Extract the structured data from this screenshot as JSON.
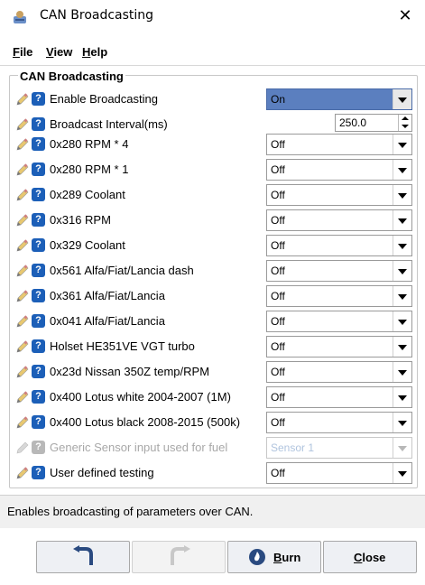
{
  "window": {
    "title": "CAN Broadcasting",
    "close_glyph": "✕"
  },
  "menu": [
    {
      "label": "File"
    },
    {
      "label": "View"
    },
    {
      "label": "Help"
    }
  ],
  "panel": {
    "title": "CAN Broadcasting"
  },
  "rows": [
    {
      "label": "Enable Broadcasting",
      "value": "On",
      "kind": "select"
    },
    {
      "label": "Broadcast Interval(ms)",
      "value": "250.0",
      "kind": "spinner"
    },
    {
      "label": "0x280 RPM * 4",
      "value": "Off",
      "kind": "select"
    },
    {
      "label": "0x280 RPM * 1",
      "value": "Off",
      "kind": "select"
    },
    {
      "label": "0x289 Coolant",
      "value": "Off",
      "kind": "select"
    },
    {
      "label": "0x316 RPM",
      "value": "Off",
      "kind": "select"
    },
    {
      "label": "0x329 Coolant",
      "value": "Off",
      "kind": "select"
    },
    {
      "label": "0x561 Alfa/Fiat/Lancia dash",
      "value": "Off",
      "kind": "select"
    },
    {
      "label": "0x361 Alfa/Fiat/Lancia",
      "value": "Off",
      "kind": "select"
    },
    {
      "label": "0x041 Alfa/Fiat/Lancia",
      "value": "Off",
      "kind": "select"
    },
    {
      "label": "Holset HE351VE VGT turbo",
      "value": "Off",
      "kind": "select"
    },
    {
      "label": "0x23d Nissan 350Z temp/RPM",
      "value": "Off",
      "kind": "select"
    },
    {
      "label": "0x400 Lotus white 2004-2007 (1M)",
      "value": "Off",
      "kind": "select"
    },
    {
      "label": "0x400 Lotus black 2008-2015 (500k)",
      "value": "Off",
      "kind": "select"
    },
    {
      "label": "Generic Sensor input used for fuel",
      "value": "Sensor 1",
      "kind": "select",
      "disabled": true
    },
    {
      "label": "User defined testing",
      "value": "Off",
      "kind": "select"
    }
  ],
  "status": {
    "text": "Enables broadcasting of parameters over CAN."
  },
  "buttons": {
    "undo_icon": "undo-arrow-icon",
    "redo_icon": "redo-arrow-icon",
    "burn_label": "Burn",
    "close_label": "Close"
  },
  "colors": {
    "selected_select_bg": "#5b7fbf",
    "help_icon": "#1c5fb8"
  }
}
